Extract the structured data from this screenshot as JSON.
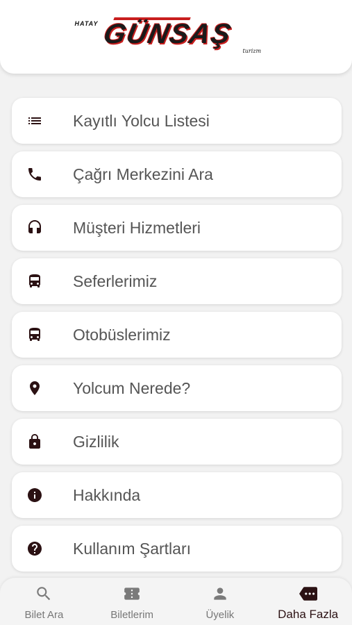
{
  "header": {
    "logo_prefix": "HATAY",
    "logo_main": "GÜNSAŞ",
    "logo_sub": "turizm"
  },
  "menu": {
    "items": [
      {
        "label": "Kayıtlı Yolcu Listesi",
        "icon": "list-icon"
      },
      {
        "label": "Çağrı Merkezini Ara",
        "icon": "phone-icon"
      },
      {
        "label": "Müşteri Hizmetleri",
        "icon": "headset-icon"
      },
      {
        "label": "Seferlerimiz",
        "icon": "bus-icon"
      },
      {
        "label": "Otobüslerimiz",
        "icon": "bus-icon"
      },
      {
        "label": "Yolcum Nerede?",
        "icon": "location-pin-icon"
      },
      {
        "label": "Gizlilik",
        "icon": "lock-icon"
      },
      {
        "label": "Hakkında",
        "icon": "info-icon"
      },
      {
        "label": "Kullanım Şartları",
        "icon": "help-icon"
      }
    ]
  },
  "tabbar": {
    "tabs": [
      {
        "label": "Bilet Ara",
        "icon": "search-icon",
        "active": false
      },
      {
        "label": "Biletlerim",
        "icon": "ticket-icon",
        "active": false
      },
      {
        "label": "Üyelik",
        "icon": "person-icon",
        "active": false
      },
      {
        "label": "Daha Fazla",
        "icon": "more-icon",
        "active": true
      }
    ]
  },
  "colors": {
    "accent": "#2b1113",
    "logo_red": "#c81e1e",
    "background": "#f2f2f2"
  }
}
